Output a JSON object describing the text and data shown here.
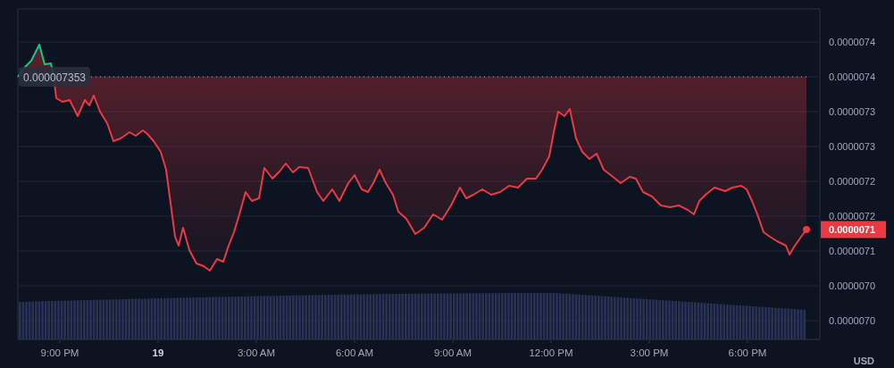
{
  "price_axis": {
    "labels": [
      "0.0000074",
      "0.0000074",
      "0.0000073",
      "0.0000073",
      "0.0000072",
      "0.0000072",
      "0.0000071",
      "0.0000070",
      "0.0000070"
    ],
    "currency": "USD"
  },
  "time_axis": {
    "labels": [
      {
        "text": "9:00 PM",
        "kind": "time"
      },
      {
        "text": "19",
        "kind": "day"
      },
      {
        "text": "3:00 AM",
        "kind": "time"
      },
      {
        "text": "6:00 AM",
        "kind": "time"
      },
      {
        "text": "9:00 AM",
        "kind": "time"
      },
      {
        "text": "12:00 PM",
        "kind": "time"
      },
      {
        "text": "3:00 PM",
        "kind": "time"
      },
      {
        "text": "6:00 PM",
        "kind": "time"
      }
    ]
  },
  "reference_price": "0.000007353",
  "last_price": "0.0000071"
}
